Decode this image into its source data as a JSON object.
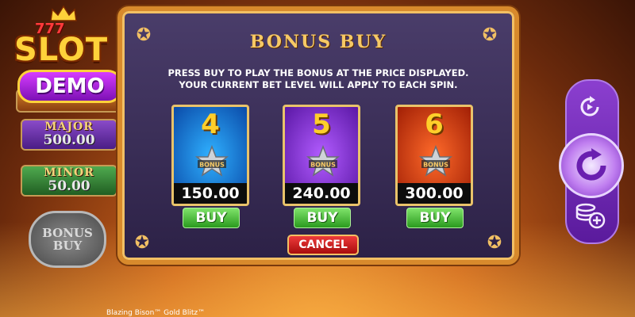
{
  "logo": {
    "top_text": "777",
    "main_text": "SLOT",
    "sub_text": "DEMO"
  },
  "jackpots": {
    "major": {
      "label": "MAJOR",
      "value": "500.00"
    },
    "minor": {
      "label": "MINOR",
      "value": "50.00"
    }
  },
  "side_bonus_button": {
    "line1": "BONUS",
    "line2": "BUY"
  },
  "dialog": {
    "title": "BONUS BUY",
    "instruction_line1": "PRESS BUY TO PLAY THE BONUS AT THE PRICE DISPLAYED.",
    "instruction_line2": "YOUR CURRENT BET LEVEL WILL APPLY TO EACH SPIN.",
    "badge_text": "BONUS",
    "options": [
      {
        "spins": "4",
        "price": "150.00",
        "buy_label": "BUY",
        "color": "#1a7be0"
      },
      {
        "spins": "5",
        "price": "240.00",
        "buy_label": "BUY",
        "color": "#8a2fd6"
      },
      {
        "spins": "6",
        "price": "300.00",
        "buy_label": "BUY",
        "color": "#e0461a"
      }
    ],
    "cancel_label": "CANCEL"
  },
  "controls": {
    "icons": [
      "autoplay-icon",
      "spin-icon",
      "bet-settings-icon"
    ]
  },
  "footer": {
    "game_title": "Blazing Bison™ Gold Blitz™"
  },
  "colors": {
    "frame": "#d88a2c",
    "title": "#f6c965",
    "buy": "#2a9a1e",
    "cancel": "#a80d0d"
  }
}
